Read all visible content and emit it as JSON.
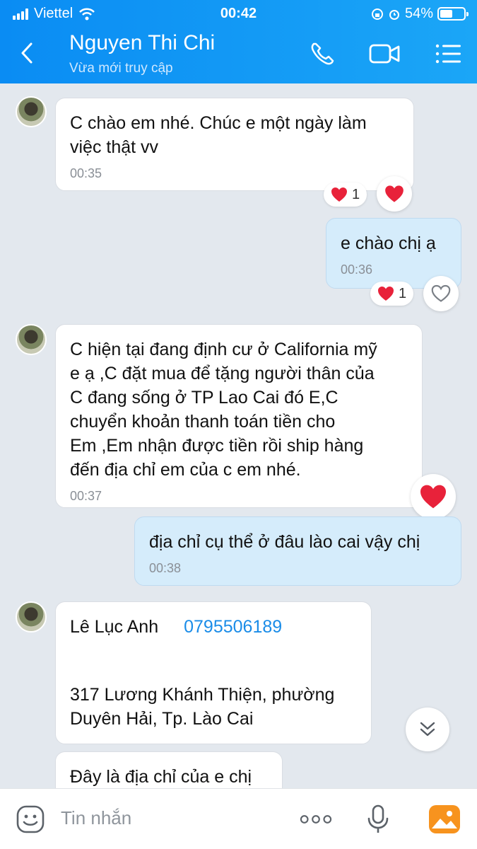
{
  "status_bar": {
    "carrier": "Viettel",
    "time": "00:42",
    "battery": "54%",
    "battery_level": 0.54
  },
  "header": {
    "name": "Nguyen Thi Chi",
    "subtitle": "Vừa mới truy cập",
    "icons": [
      "back-arrow-icon",
      "phone-icon",
      "video-icon",
      "menu-icon"
    ]
  },
  "messages": [
    {
      "from": "other",
      "lines": [
        "C chào em nhé. Chúc e một ngày làm",
        "việc thật vv"
      ],
      "time": "00:35",
      "reaction_count": "1"
    },
    {
      "from": "me",
      "lines": [
        "e chào chị ạ"
      ],
      "time": "00:36",
      "reaction_count": "1"
    },
    {
      "from": "other",
      "lines": [
        "C hiện tại đang định cư ở California mỹ",
        "e ạ ,C đặt mua để tặng người thân của",
        "C đang sống ở TP Lao Cai đó E,C",
        "chuyển khoản thanh toán tiền cho",
        "Em ,Em nhận được tiền rồi ship hàng",
        "đến địa chỉ em  của c em  nhé."
      ],
      "time": "00:37"
    },
    {
      "from": "me",
      "lines": [
        "địa chỉ cụ thể ở đâu lào cai vậy chị"
      ],
      "time": "00:38"
    },
    {
      "from": "other",
      "name_line": "Lê Lục Anh",
      "phone": "0795506189",
      "lines": [
        "317 Lương Khánh Thiện, phường",
        "Duyên Hải, Tp. Lào Cai"
      ]
    },
    {
      "from": "other",
      "lines": [
        "Đây là địa chỉ của e chị"
      ]
    }
  ],
  "composer": {
    "placeholder": "Tin nhắn"
  },
  "colors": {
    "header": "#0a8cf3",
    "my_bubble": "#d5ecfb",
    "heart": "#e8223a",
    "link": "#1a8ce8"
  }
}
